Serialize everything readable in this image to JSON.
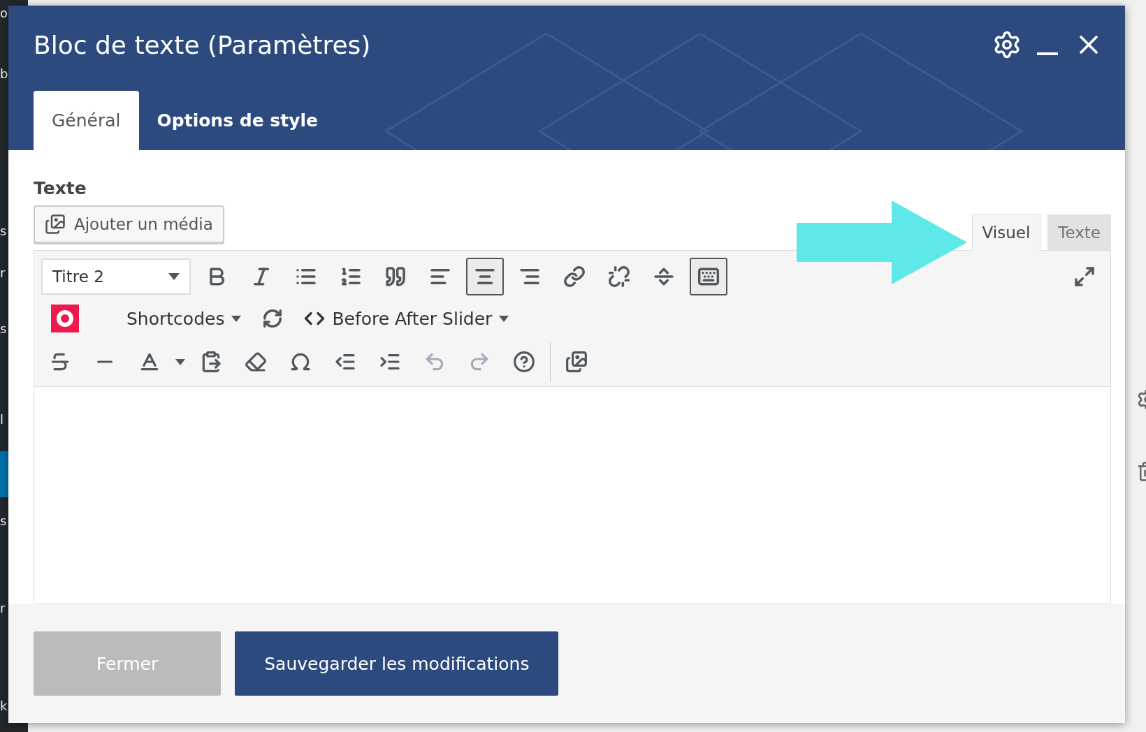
{
  "background_sidebar": [
    "o",
    "b",
    "s",
    "r",
    "s",
    "l",
    "s",
    "r",
    "k"
  ],
  "dialog": {
    "title": "Bloc de texte (Paramètres)",
    "tabs": [
      {
        "label": "Général",
        "selected": true
      },
      {
        "label": "Options de style",
        "selected": false
      }
    ],
    "field_label": "Texte",
    "media_button": "Ajouter un média",
    "editor_tabs": [
      {
        "label": "Visuel",
        "selected": true
      },
      {
        "label": "Texte",
        "selected": false
      }
    ],
    "format_select": "Titre 2",
    "toolbar_row_1": [
      {
        "pressed": false
      },
      {
        "pressed": false
      },
      {
        "pressed": false
      },
      {
        "pressed": false
      },
      {
        "pressed": false
      },
      {
        "pressed": false
      },
      {
        "pressed": true
      },
      {
        "pressed": false
      },
      {
        "pressed": false
      },
      {
        "pressed": false
      },
      {
        "pressed": false
      },
      {
        "pressed": true
      }
    ],
    "toolbar_row_2": [
      {
        "kind": "logo"
      },
      {
        "kind": "menu",
        "label": "Shortcodes"
      },
      {
        "kind": "icon"
      },
      {
        "kind": "menu",
        "label": "Before After Slider"
      }
    ],
    "toolbar_row_3": [
      {
        "disabled": false
      },
      {
        "disabled": false
      },
      {
        "disabled": false
      },
      {
        "disabled": false
      },
      {
        "disabled": false
      },
      {
        "disabled": false
      },
      {
        "disabled": false
      },
      {
        "disabled": false
      },
      {
        "disabled": true
      },
      {
        "disabled": true
      },
      {
        "disabled": false
      },
      {
        "disabled": false
      }
    ],
    "buttons": [
      {
        "label": "Fermer",
        "kind": "secondary"
      },
      {
        "label": "Sauvegarder les modifications",
        "kind": "primary"
      }
    ]
  }
}
